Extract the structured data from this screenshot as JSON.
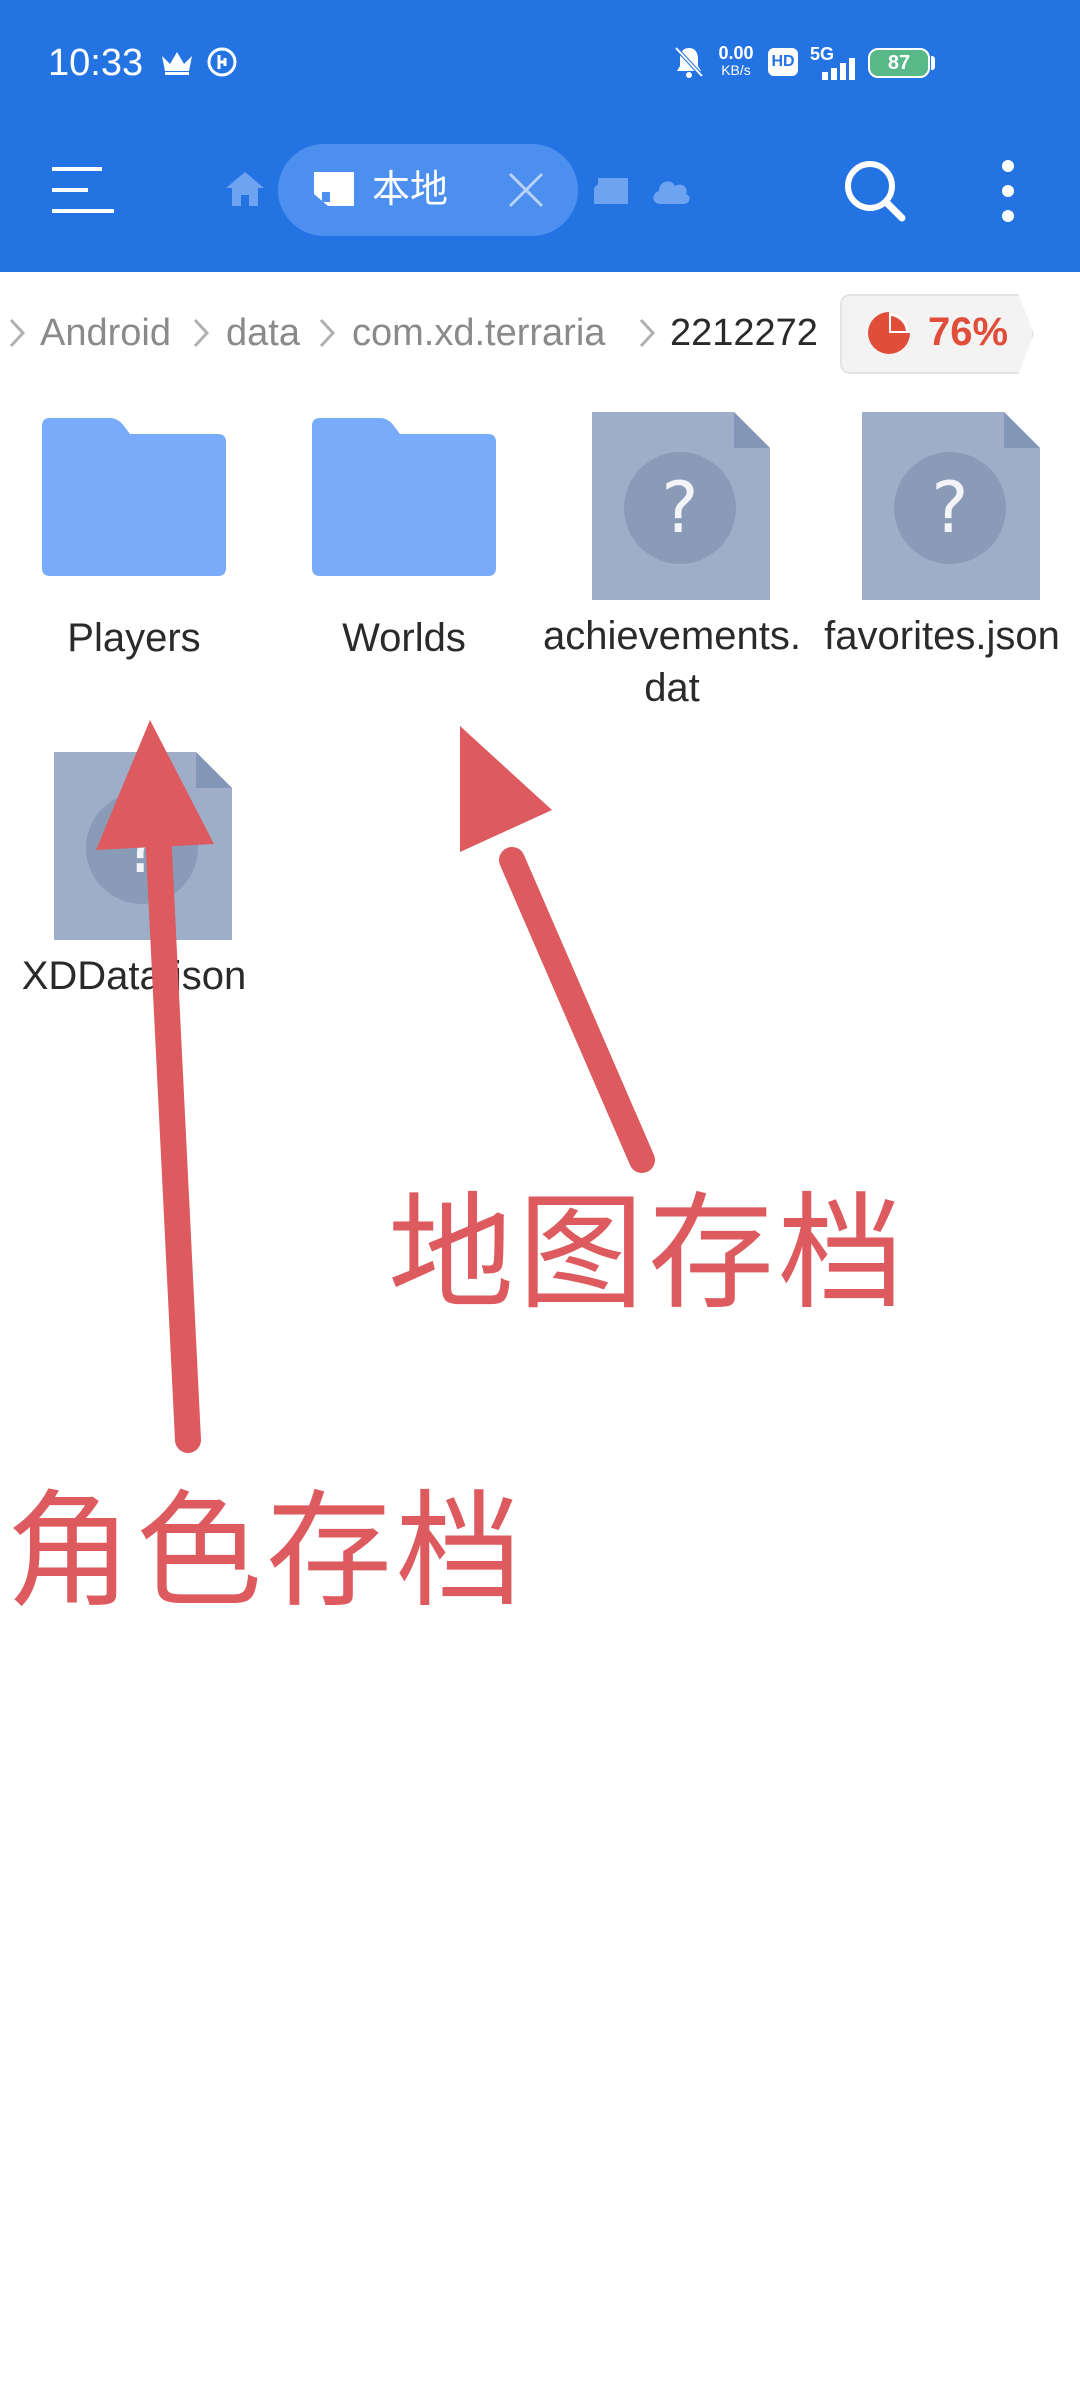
{
  "status_bar": {
    "time": "10:33",
    "net_speed_value": "0.00",
    "net_speed_unit": "KB/s",
    "hd_label": "HD",
    "network_label": "5G",
    "battery": "87"
  },
  "toolbar": {
    "tab_label": "本地"
  },
  "breadcrumb": {
    "items": [
      "Android",
      "data",
      "com.xd.terraria",
      "2212272"
    ],
    "storage_percent": "76%"
  },
  "files": [
    {
      "name": "Players",
      "type": "folder"
    },
    {
      "name": "Worlds",
      "type": "folder"
    },
    {
      "name": "achievements.dat",
      "type": "file"
    },
    {
      "name": "favorites.json",
      "type": "file"
    },
    {
      "name": "XDData.json",
      "type": "file"
    }
  ],
  "annotations": {
    "worlds_label": "地图存档",
    "players_label": "角色存档"
  },
  "colors": {
    "topbar": "#2473e3",
    "folder": "#78acfa",
    "file": "#9eadc8",
    "annotation": "#dd5a5e",
    "storage_accent": "#e04e3a"
  }
}
